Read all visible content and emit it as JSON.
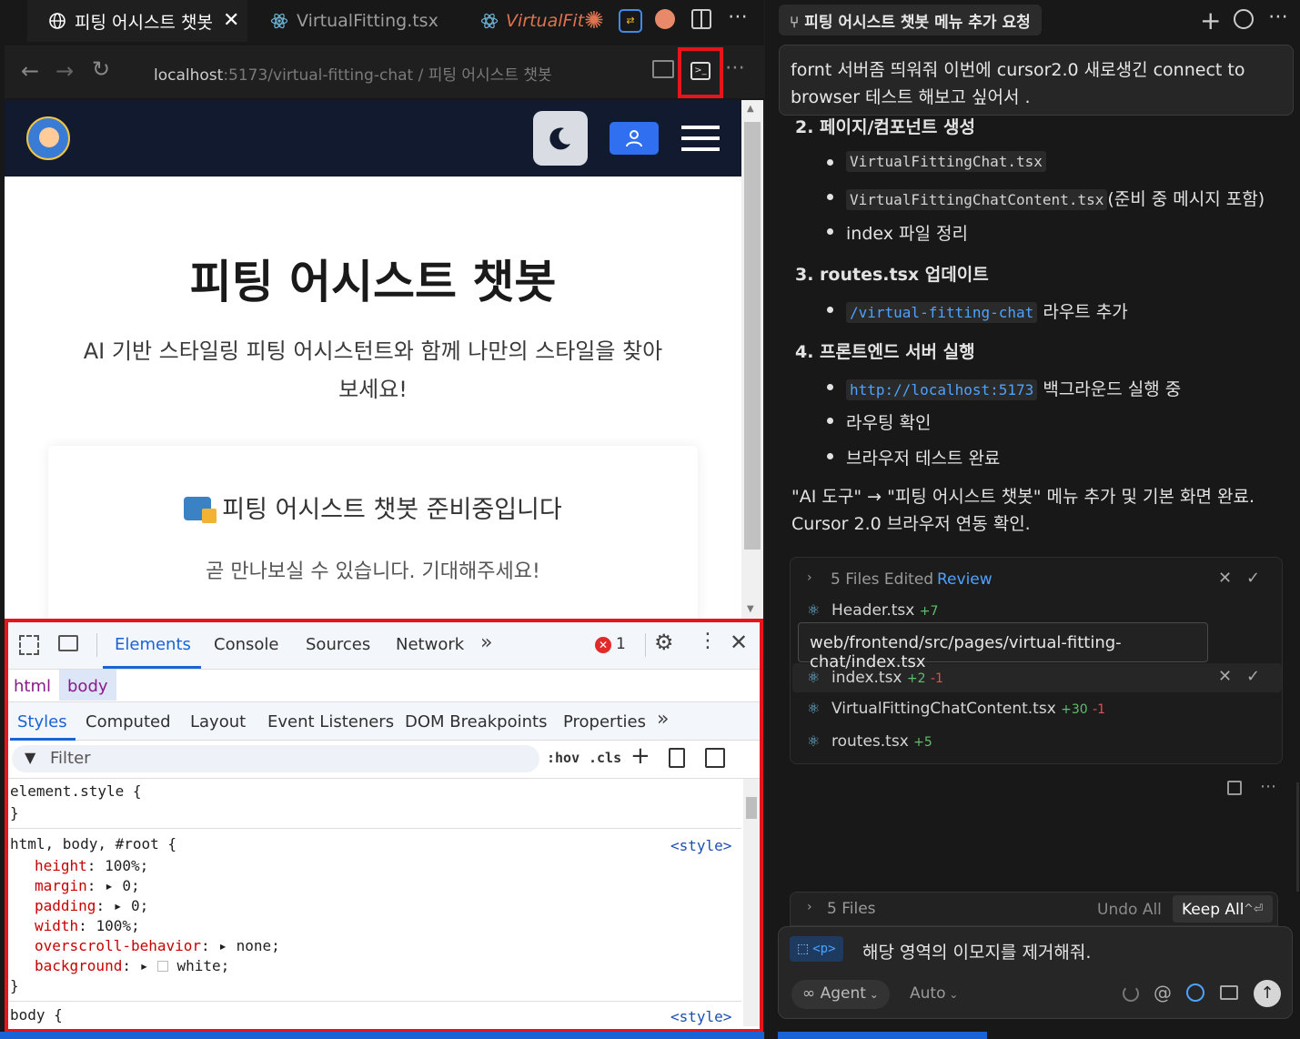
{
  "browser": {
    "tabs": [
      {
        "label": "피팅 어시스트 챗봇",
        "active": true
      },
      {
        "label": "VirtualFitting.tsx"
      },
      {
        "label": "VirtualFit"
      }
    ],
    "url_host": "localhost",
    "url_path": ":5173/virtual-fitting-chat / 피팅 어시스트 챗봇"
  },
  "page": {
    "title": "피팅 어시스트 챗봇",
    "subtitle_line1": "AI 기반 스타일링 피팅 어시스턴트와 함께 나만의 스타일을 찾아",
    "subtitle_line2": "보세요!",
    "card_title": "피팅 어시스트 챗봇 준비중입니다",
    "card_sub": "곧 만나보실 수 있습니다. 기대해주세요!"
  },
  "devtools": {
    "tabs": [
      "Elements",
      "Console",
      "Sources",
      "Network"
    ],
    "error_count": "1",
    "breadcrumb": [
      "html",
      "body"
    ],
    "subtabs": [
      "Styles",
      "Computed",
      "Layout",
      "Event Listeners",
      "DOM Breakpoints",
      "Properties"
    ],
    "filter_placeholder": "Filter",
    "hov": ":hov",
    "cls": ".cls",
    "rules": {
      "element_style": "element.style {",
      "close": "}",
      "selector2": "html, body, #root {",
      "source": "<style>",
      "height_name": "height",
      "height_val": "100%;",
      "margin_name": "margin",
      "margin_val": "0;",
      "padding_name": "padding",
      "padding_val": "0;",
      "width_name": "width",
      "width_val": "100%;",
      "overscroll_name": "overscroll-behavior",
      "overscroll_val": "none;",
      "background_name": "background",
      "background_val": "white;",
      "selector3": "body {"
    }
  },
  "chat": {
    "header_title": "피팅 어시스트 챗봇 메뉴 추가 요청",
    "user_msg_line1": "fornt 서버좀 띄워줘 이번에 cursor2.0 새로생긴 connect to",
    "user_msg_line2": "browser 테스트 해보고 싶어서 .",
    "item2": "2. 페이지/컴포넌트 생성",
    "item2_b1": "VirtualFittingChat.tsx",
    "item2_b2_code": "VirtualFittingChatContent.tsx",
    "item2_b2_text": "(준비 중 메시지 포함)",
    "item2_b3": "index 파일 정리",
    "item3": "3. routes.tsx 업데이트",
    "item3_b1_code": "/virtual-fitting-chat",
    "item3_b1_text": "라우트 추가",
    "item4": "4. 프론트엔드 서버 실행",
    "item4_b1_code": "http://localhost:5173",
    "item4_b1_text": "백그라운드 실행 중",
    "item4_b2": "라우팅 확인",
    "item4_b3": "브라우저 테스트 완료",
    "summary_line1": "\"AI 도구\" → \"피팅 어시스트 챗봇\" 메뉴 추가 및 기본 화면 완료.",
    "summary_line2": "Cursor 2.0 브라우저 연동 확인.",
    "files_edited": "5 Files Edited",
    "review": "Review",
    "files": [
      {
        "name": "Header.tsx",
        "plus": "+7",
        "minus": ""
      },
      {
        "name": "index.tsx",
        "plus": "+2",
        "minus": "-1"
      },
      {
        "name": "VirtualFittingChatContent.tsx",
        "plus": "+30",
        "minus": "-1"
      },
      {
        "name": "routes.tsx",
        "plus": "+5",
        "minus": ""
      }
    ],
    "tooltip": "web/frontend/src/pages/virtual-fitting-chat/index.tsx",
    "bottom_files": "5 Files",
    "undo_all": "Undo All",
    "keep_all": "Keep All",
    "keep_shortcut": "^⏎",
    "context_tag": "<p>",
    "input_text": "해당 영역의 이모지를 제거해줘.",
    "agent_label": "Agent",
    "auto_label": "Auto"
  },
  "colors": {
    "accent_red": "#e8141b",
    "link_blue": "#4ea2ff",
    "nav_dark": "#111a2e",
    "user_btn": "#2f6ff0"
  }
}
